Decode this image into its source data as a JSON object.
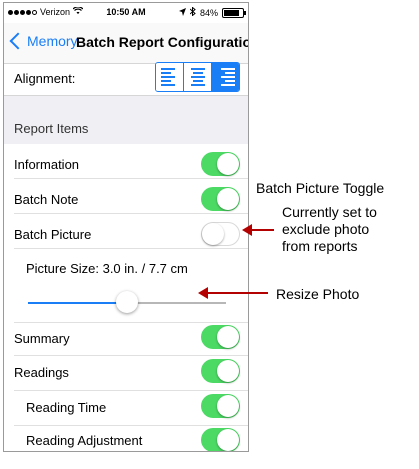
{
  "status_bar": {
    "carrier": "Verizon",
    "time": "10:50 AM",
    "battery": "84%",
    "battery_level": 0.84
  },
  "nav": {
    "back_label": "Memory",
    "title": "Batch Report Configuration"
  },
  "alignment": {
    "label": "Alignment:",
    "options": [
      "align-left",
      "align-center",
      "align-right"
    ],
    "selected": "align-right"
  },
  "section": {
    "header": "Report Items"
  },
  "items": [
    {
      "label": "Information",
      "on": true
    },
    {
      "label": "Batch Note",
      "on": true
    },
    {
      "label": "Batch Picture",
      "on": false
    }
  ],
  "picture_size": {
    "label": "Picture Size: 3.0 in. / 7.7 cm",
    "level": 0.5
  },
  "items2": [
    {
      "label": "Summary",
      "on": true
    },
    {
      "label": "Readings",
      "on": true
    },
    {
      "label": "Reading Time",
      "on": true
    },
    {
      "label": "Reading Adjustment",
      "on": true
    }
  ],
  "annotations": {
    "toggle_title": "Batch Picture Toggle",
    "toggle_note": [
      "Currently set to",
      "exclude photo",
      "from reports"
    ],
    "resize": "Resize Photo"
  },
  "colors": {
    "accent": "#1a7ef6",
    "toggle_on": "#4cd964",
    "arrow": "#b30000"
  }
}
